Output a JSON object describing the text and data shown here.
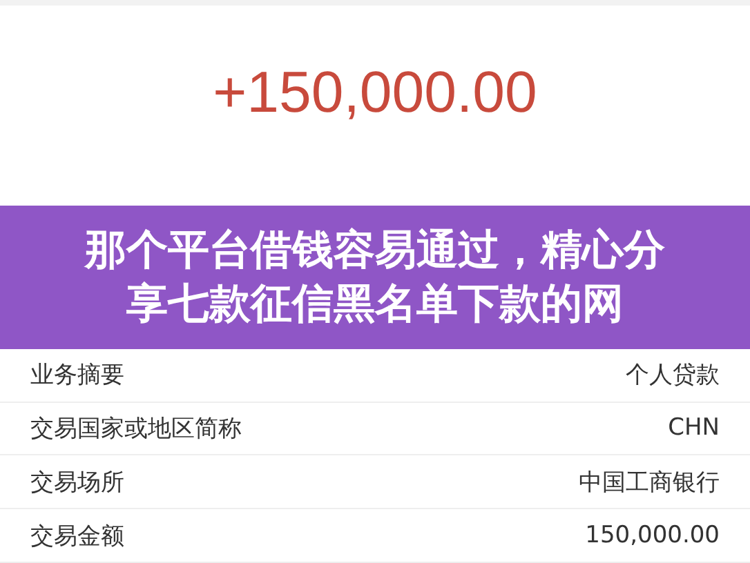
{
  "amount": "+150,000.00",
  "banner": {
    "title": "那个平台借钱容易通过，精心分享七款征信黑名单下款的网"
  },
  "details": [
    {
      "label": "业务摘要",
      "value": "个人贷款"
    },
    {
      "label": "交易国家或地区简称",
      "value": "CHN"
    },
    {
      "label": "交易场所",
      "value": "中国工商银行"
    },
    {
      "label": "交易金额",
      "value": "150,000.00"
    }
  ]
}
